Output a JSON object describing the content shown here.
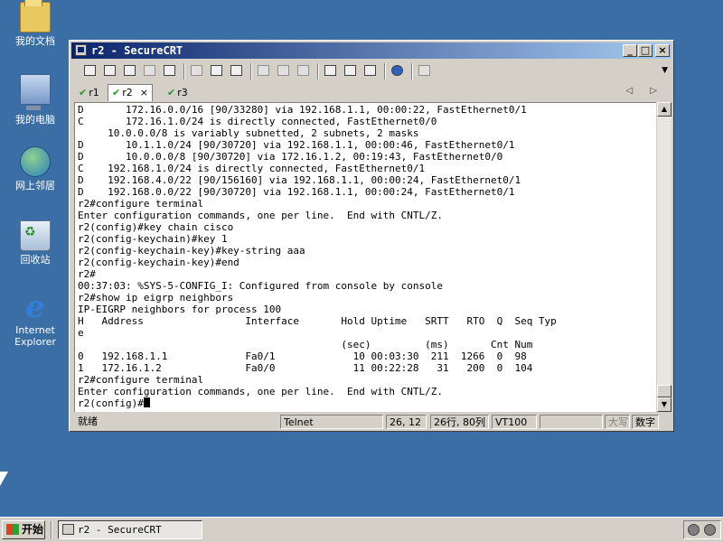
{
  "desktop": {
    "icons": [
      {
        "label": "我的文档",
        "icon": "my-documents-icon"
      },
      {
        "label": "我的电脑",
        "icon": "my-computer-icon"
      },
      {
        "label": "网上邻居",
        "icon": "network-places-icon"
      },
      {
        "label": "回收站",
        "icon": "recycle-bin-icon"
      },
      {
        "label": "Internet Explorer",
        "icon": "internet-explorer-icon"
      }
    ]
  },
  "window": {
    "title": "r2 - SecureCRT",
    "buttons": {
      "minimize": "_",
      "maximize": "□",
      "close": "×"
    },
    "tabs": [
      {
        "label": "r1",
        "active": false
      },
      {
        "label": "r2",
        "active": true,
        "close": "×"
      },
      {
        "label": "r3",
        "active": false
      }
    ],
    "tab_nav": "◁ ▷",
    "terminal": {
      "lines": [
        "D       172.16.0.0/16 [90/33280] via 192.168.1.1, 00:00:22, FastEthernet0/1",
        "C       172.16.1.0/24 is directly connected, FastEthernet0/0",
        "     10.0.0.0/8 is variably subnetted, 2 subnets, 2 masks",
        "D       10.1.1.0/24 [90/30720] via 192.168.1.1, 00:00:46, FastEthernet0/1",
        "D       10.0.0.0/8 [90/30720] via 172.16.1.2, 00:19:43, FastEthernet0/0",
        "C    192.168.1.0/24 is directly connected, FastEthernet0/1",
        "D    192.168.4.0/22 [90/156160] via 192.168.1.1, 00:00:24, FastEthernet0/1",
        "D    192.168.0.0/22 [90/30720] via 192.168.1.1, 00:00:24, FastEthernet0/1",
        "r2#configure terminal",
        "Enter configuration commands, one per line.  End with CNTL/Z.",
        "r2(config)#key chain cisco",
        "r2(config-keychain)#key 1",
        "r2(config-keychain-key)#key-string aaa",
        "r2(config-keychain-key)#end",
        "r2#",
        "00:37:03: %SYS-5-CONFIG_I: Configured from console by console",
        "r2#show ip eigrp neighbors",
        "IP-EIGRP neighbors for process 100",
        "H   Address                 Interface       Hold Uptime   SRTT   RTO  Q  Seq Typ",
        "e",
        "                                            (sec)         (ms)       Cnt Num",
        "0   192.168.1.1             Fa0/1             10 00:03:30  211  1266  0  98",
        "1   172.16.1.2              Fa0/0             11 00:22:28   31   200  0  104",
        "r2#configure terminal",
        "Enter configuration commands, one per line.  End with CNTL/Z."
      ],
      "prompt": "r2(config)#"
    },
    "status": {
      "ready": "就绪",
      "protocol": "Telnet",
      "position": "26, 12",
      "size": "26行, 80列",
      "emulation": "VT100",
      "blank": "",
      "caps": "大写",
      "num": "数字"
    }
  },
  "taskbar": {
    "start_label": "开始",
    "task_label": "r2 - SecureCRT"
  }
}
